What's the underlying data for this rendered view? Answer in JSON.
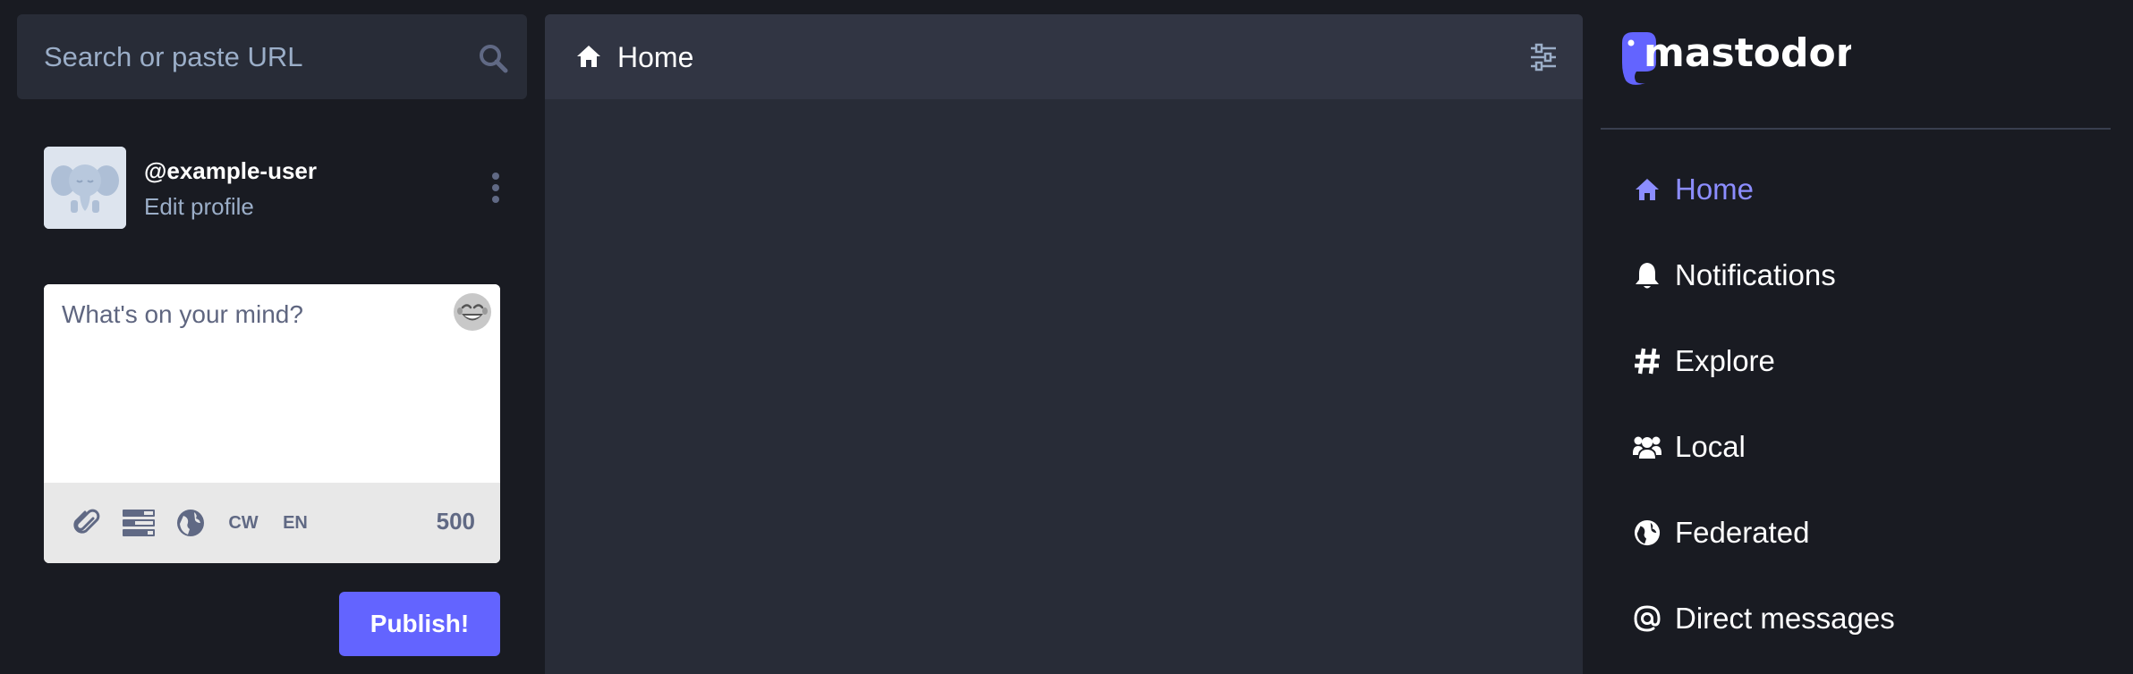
{
  "search": {
    "placeholder": "Search or paste URL",
    "icon": "search-icon"
  },
  "account": {
    "handle": "@example-user",
    "edit_profile_label": "Edit profile"
  },
  "compose": {
    "placeholder": "What's on your mind?",
    "tools": {
      "cw_label": "CW",
      "language_label": "EN"
    },
    "char_count": "500",
    "publish_label": "Publish!"
  },
  "column": {
    "title": "Home"
  },
  "brand": {
    "name": "mastodon",
    "accent_color": "#6364ff"
  },
  "nav": {
    "items": [
      {
        "label": "Home",
        "icon": "home-icon",
        "active": true
      },
      {
        "label": "Notifications",
        "icon": "bell-icon",
        "active": false
      },
      {
        "label": "Explore",
        "icon": "hashtag-icon",
        "active": false
      },
      {
        "label": "Local",
        "icon": "users-icon",
        "active": false
      },
      {
        "label": "Federated",
        "icon": "globe-icon",
        "active": false
      },
      {
        "label": "Direct messages",
        "icon": "at-icon",
        "active": false
      }
    ]
  },
  "colors": {
    "background": "#191b22",
    "panel": "#282c37",
    "header": "#313543",
    "active_nav": "#8c8dff",
    "muted_text": "#9baec8"
  }
}
